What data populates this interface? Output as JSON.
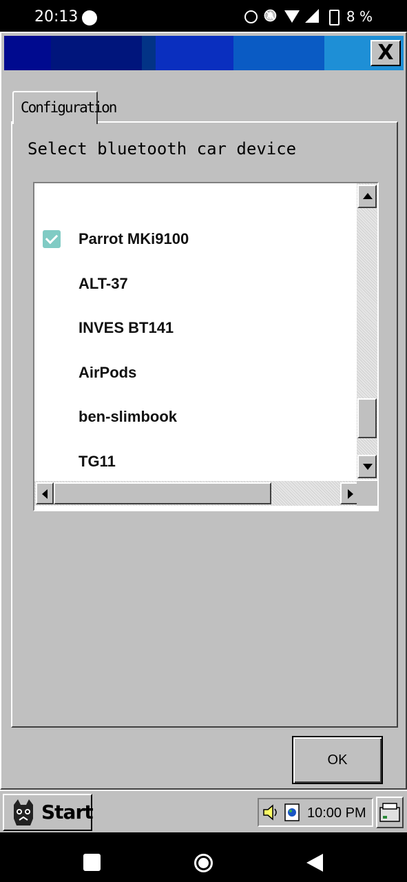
{
  "status_bar": {
    "time": "20:13",
    "battery": "8 %",
    "icons": [
      "alarm-icon",
      "bell-off-icon",
      "wifi-icon",
      "signal-icon",
      "battery-icon"
    ]
  },
  "window": {
    "title_colors": [
      "#000a8f",
      "#00157c",
      "#0a2fbf",
      "#0a5bc4",
      "#1e8fd6"
    ],
    "close_label": "X"
  },
  "tabs": [
    {
      "label": "Configuration",
      "selected": true
    }
  ],
  "panel": {
    "label": "Select bluetooth car device",
    "devices": [
      {
        "name": "Parrot MKi9100",
        "checked": true
      },
      {
        "name": "ALT-37",
        "checked": false
      },
      {
        "name": "INVES BT141",
        "checked": false
      },
      {
        "name": "AirPods",
        "checked": false
      },
      {
        "name": "ben-slimbook",
        "checked": false
      },
      {
        "name": "TG11",
        "checked": false
      }
    ],
    "checkbox_color": "#80cbc4"
  },
  "buttons": {
    "ok_label": "OK"
  },
  "taskbar": {
    "start_label": "Start",
    "clock": "10:00 PM"
  },
  "nav_bar": {
    "icons": [
      "recents-icon",
      "home-icon",
      "back-icon"
    ]
  }
}
